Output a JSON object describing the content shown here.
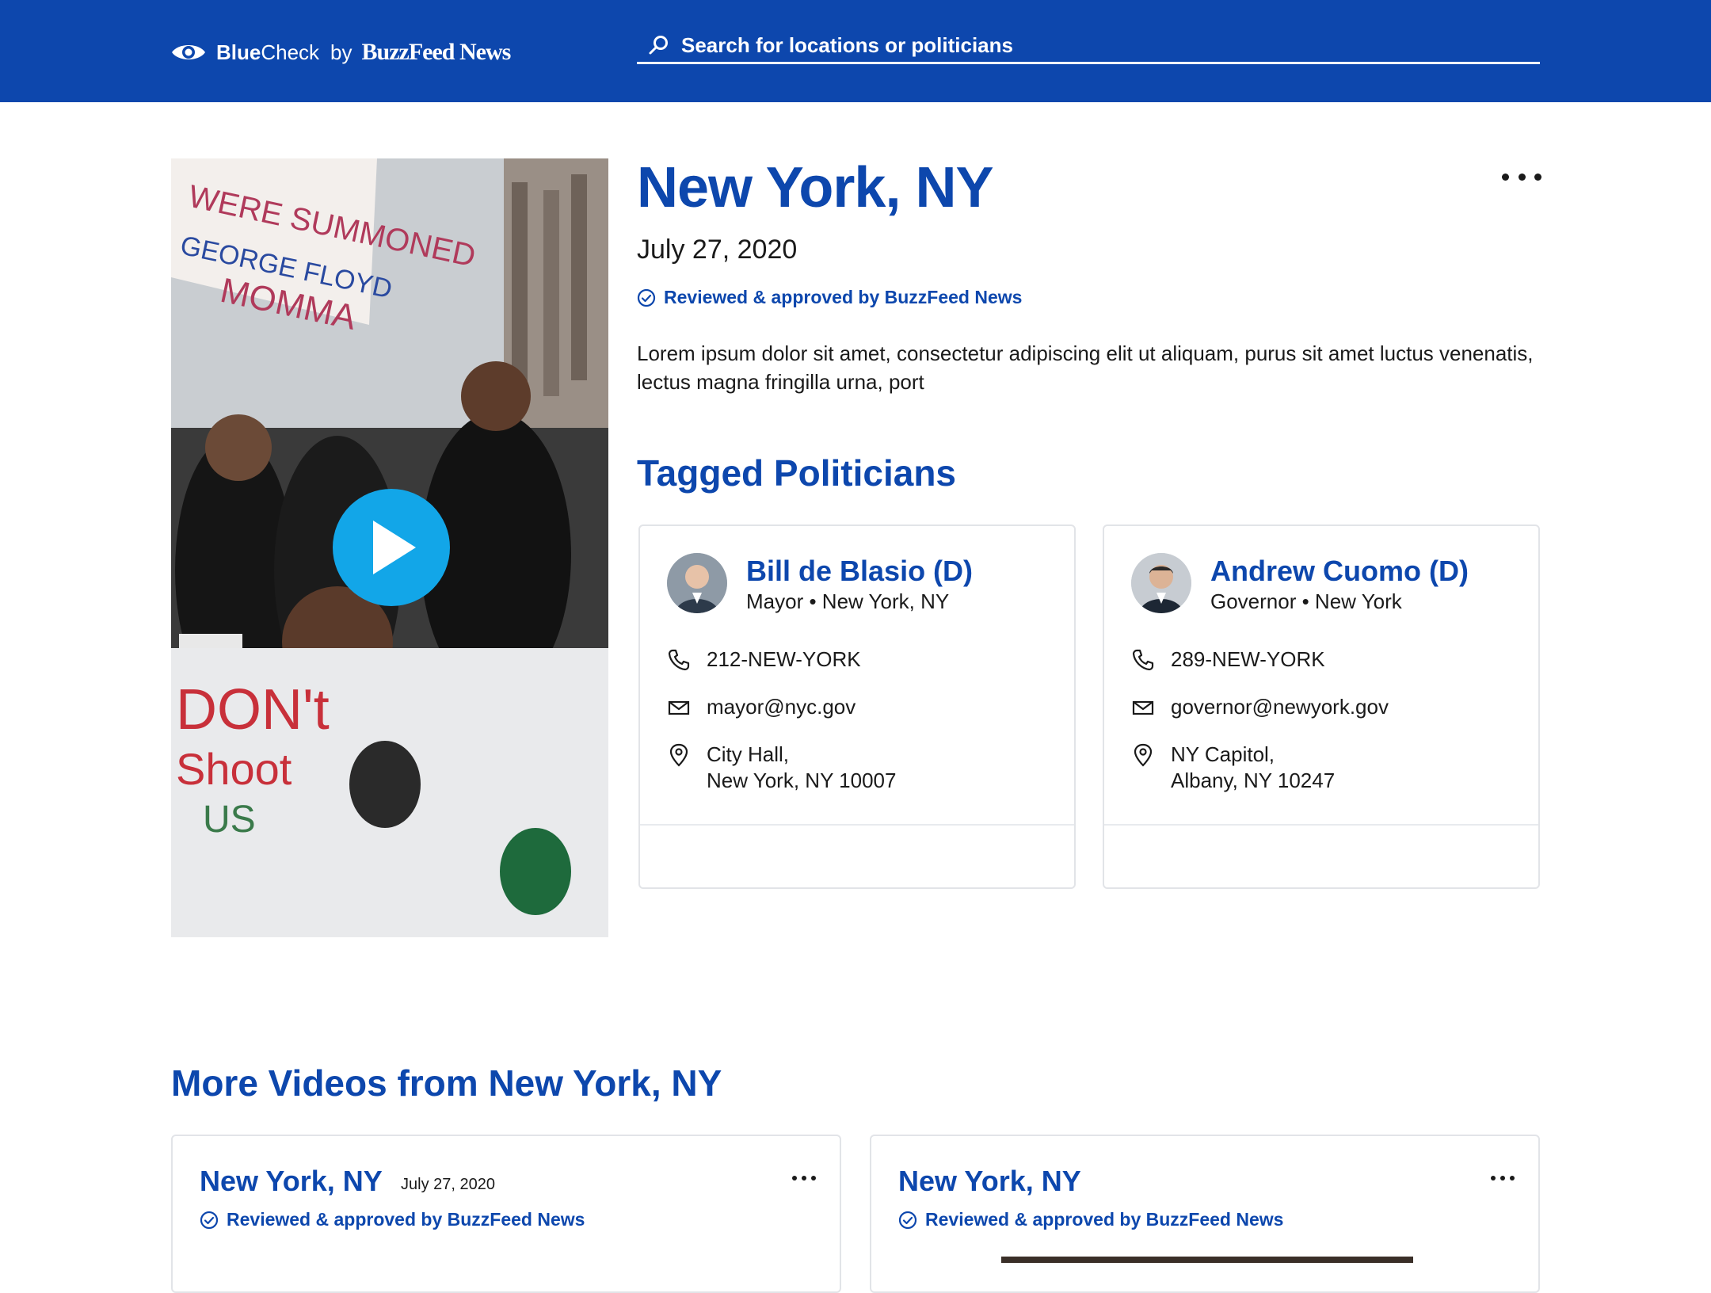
{
  "header": {
    "brand_bold": "Blue",
    "brand_light": "Check",
    "by": "by",
    "publisher": "BuzzFeed News",
    "search_placeholder": "Search for locations or politicians"
  },
  "video": {
    "play_label": "Play video"
  },
  "location": {
    "title": "New York, NY",
    "date": "July 27, 2020",
    "reviewed": "Reviewed & approved by BuzzFeed News",
    "description": "Lorem ipsum dolor sit amet, consectetur adipiscing elit ut aliquam, purus sit amet luctus venenatis, lectus magna fringilla urna, port"
  },
  "tagged": {
    "heading": "Tagged Politicians",
    "politicians": [
      {
        "name": "Bill de Blasio (D)",
        "role": "Mayor • New York, NY",
        "phone": "212-NEW-YORK",
        "email": "mayor@nyc.gov",
        "address_line1": "City Hall,",
        "address_line2": "New York, NY 10007"
      },
      {
        "name": "Andrew Cuomo (D)",
        "role": "Governor • New York",
        "phone": "289-NEW-YORK",
        "email": "governor@newyork.gov",
        "address_line1": "NY Capitol,",
        "address_line2": "Albany, NY 10247"
      }
    ]
  },
  "more_videos": {
    "heading": "More Videos from New York, NY",
    "items": [
      {
        "title": "New York, NY",
        "date": "July 27, 2020",
        "reviewed": "Reviewed & approved by BuzzFeed News"
      },
      {
        "title": "New York, NY",
        "date": "",
        "reviewed": "Reviewed & approved by BuzzFeed News"
      }
    ]
  },
  "colors": {
    "brand_blue": "#0d47ad",
    "play_blue": "#12a6e8",
    "card_border": "#e2e4e8"
  },
  "icons": [
    "eye-icon",
    "search-icon",
    "play-icon",
    "more-icon",
    "check-circle-icon",
    "phone-icon",
    "mail-icon",
    "map-pin-icon"
  ]
}
